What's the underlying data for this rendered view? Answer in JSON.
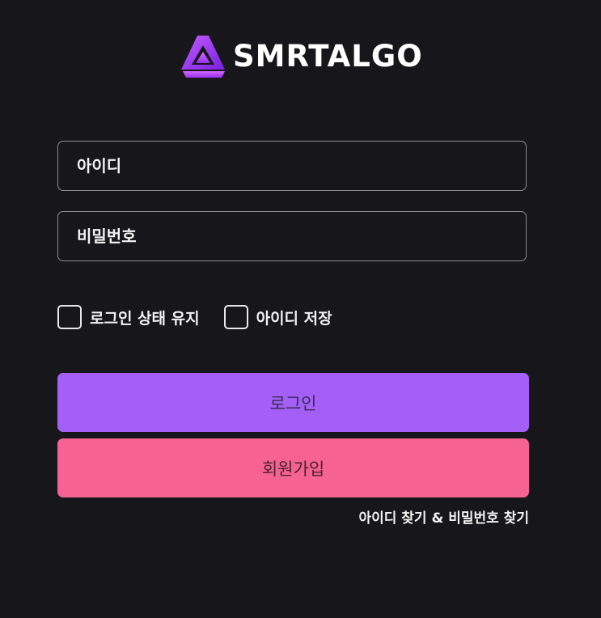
{
  "brand": {
    "name": "SMRTALGO",
    "logo_icon": "triangle-logo-icon",
    "accent_color": "#a35ff6",
    "logo_gradient": [
      "#b14cf5",
      "#7a2fe6"
    ]
  },
  "form": {
    "id_placeholder": "아이디",
    "password_placeholder": "비밀번호",
    "keep_login_label": "로그인 상태 유지",
    "save_id_label": "아이디 저장",
    "login_button": "로그인",
    "signup_button": "회원가입",
    "find_link": "아이디 찾기 & 비밀번호 찾기"
  },
  "colors": {
    "background": "#17161b",
    "login_button": "#a35ff6",
    "signup_button": "#f66392",
    "border": "#8c8a92"
  }
}
